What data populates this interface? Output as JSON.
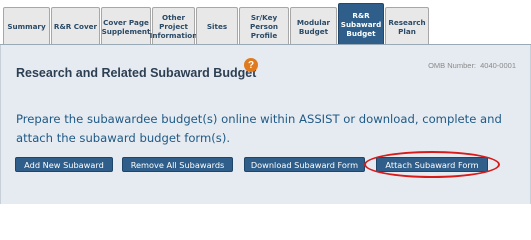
{
  "tabs": [
    {
      "label": "Summary",
      "active": false
    },
    {
      "label": "R&R Cover",
      "active": false
    },
    {
      "label": "Cover Page\nSupplement",
      "active": false
    },
    {
      "label": "Other\nProject\nInformation",
      "active": false
    },
    {
      "label": "Sites",
      "active": false
    },
    {
      "label": "Sr/Key\nPerson\nProfile",
      "active": false
    },
    {
      "label": "Modular\nBudget",
      "active": false
    },
    {
      "label": "R&R\nSubaward\nBudget",
      "active": true
    },
    {
      "label": "Research\nPlan",
      "active": false
    }
  ],
  "page": {
    "title": "Research and Related Subaward Budget",
    "help_glyph": "?",
    "omb_label": "OMB Number:",
    "omb_number": "4040-0001",
    "instructions": "Prepare the subawardee budget(s) online within ASSIST or download, complete and attach the subaward budget form(s)."
  },
  "buttons": {
    "add_new": "Add New Subaward",
    "remove_all": "Remove All Subawards",
    "download": "Download Subaward Form",
    "attach": "Attach Subaward Form"
  },
  "colors": {
    "accent": "#2f5e8a",
    "panel_bg": "#e6ebf1",
    "highlight": "#d91a1a",
    "help_icon": "#e07a1f"
  }
}
